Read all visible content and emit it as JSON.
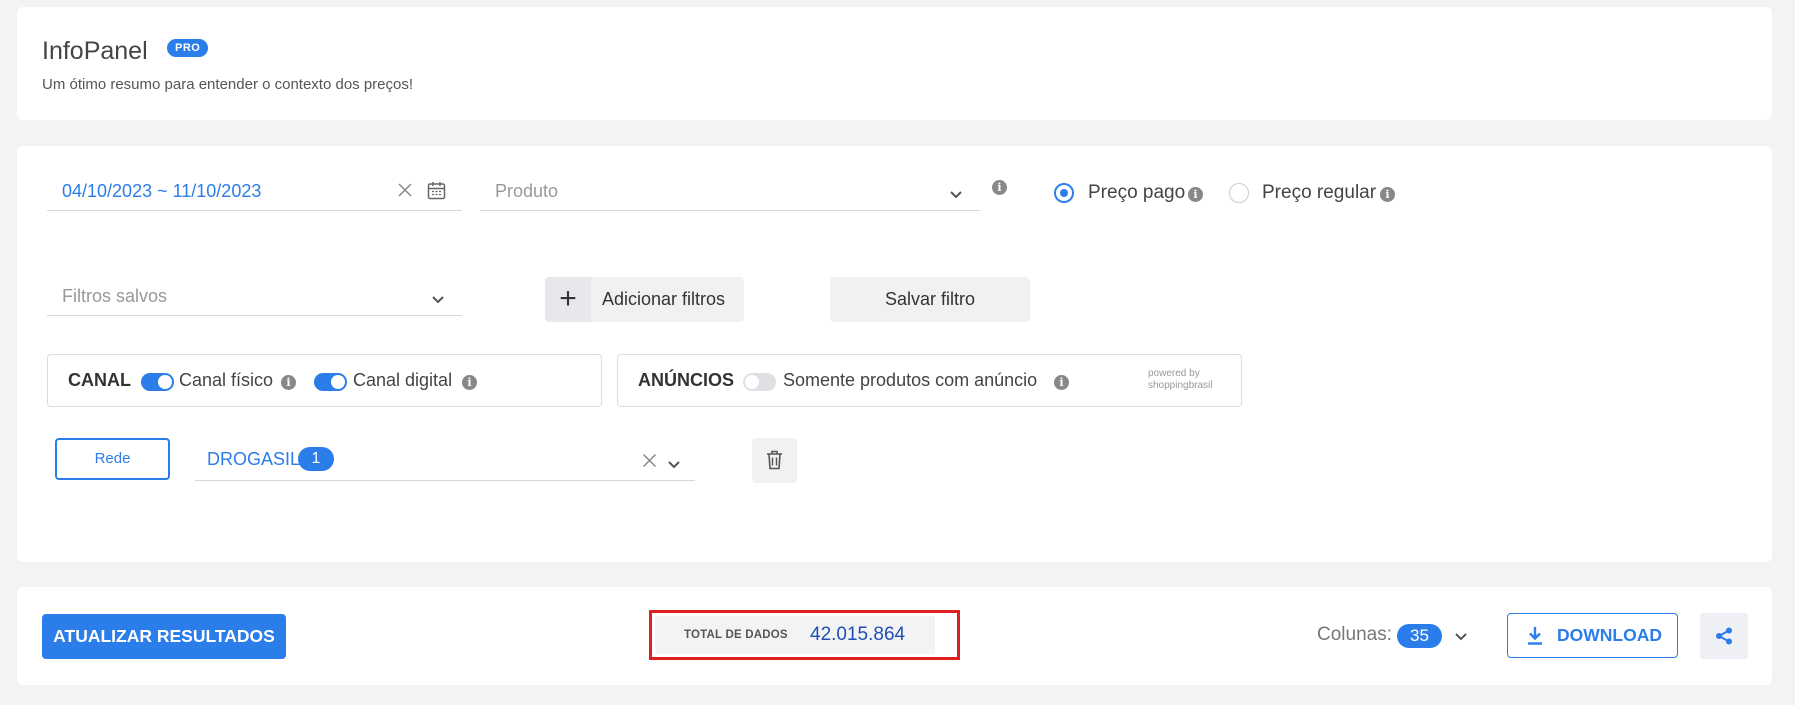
{
  "header": {
    "title": "InfoPanel",
    "badge": "PRO",
    "subtitle": "Um ótimo resumo para entender o contexto dos preços!"
  },
  "filters": {
    "date_range": "04/10/2023 ~ 11/10/2023",
    "product_placeholder": "Produto",
    "price_options": [
      {
        "label": "Preço pago",
        "selected": true
      },
      {
        "label": "Preço regular",
        "selected": false
      }
    ],
    "saved_filters_placeholder": "Filtros salvos",
    "add_filters_label": "Adicionar filtros",
    "save_filter_label": "Salvar filtro"
  },
  "canal": {
    "title": "CANAL",
    "options": [
      {
        "label": "Canal físico",
        "on": true
      },
      {
        "label": "Canal digital",
        "on": true
      }
    ]
  },
  "anuncios": {
    "title": "ANÚNCIOS",
    "option": {
      "label": "Somente produtos com anúncio",
      "on": false
    },
    "powered_by": "powered by",
    "brand": "shoppingbrasil"
  },
  "rede": {
    "button_label": "Rede",
    "value": "DROGASIL",
    "count": "1"
  },
  "footer": {
    "update_label": "ATUALIZAR RESULTADOS",
    "total_label": "TOTAL DE DADOS",
    "total_value": "42.015.864",
    "columns_label": "Colunas:",
    "columns_count": "35",
    "download_label": "DOWNLOAD"
  },
  "colors": {
    "accent": "#2b7de9",
    "highlight_border": "#e02020"
  }
}
